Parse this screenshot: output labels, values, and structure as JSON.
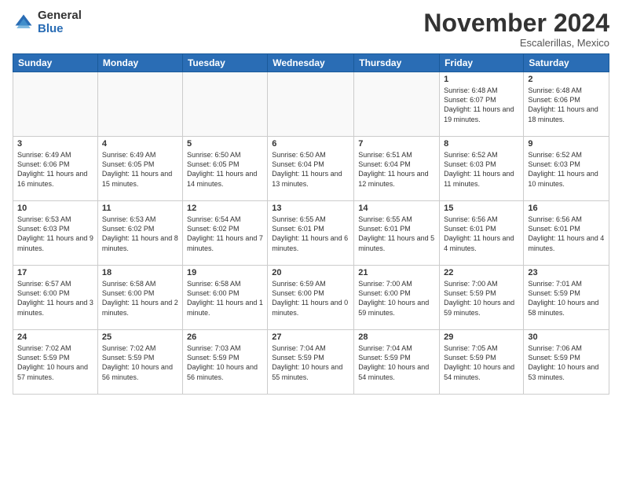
{
  "header": {
    "logo_general": "General",
    "logo_blue": "Blue",
    "month_title": "November 2024",
    "location": "Escalerillas, Mexico"
  },
  "weekdays": [
    "Sunday",
    "Monday",
    "Tuesday",
    "Wednesday",
    "Thursday",
    "Friday",
    "Saturday"
  ],
  "weeks": [
    [
      {
        "day": "",
        "info": ""
      },
      {
        "day": "",
        "info": ""
      },
      {
        "day": "",
        "info": ""
      },
      {
        "day": "",
        "info": ""
      },
      {
        "day": "",
        "info": ""
      },
      {
        "day": "1",
        "info": "Sunrise: 6:48 AM\nSunset: 6:07 PM\nDaylight: 11 hours and 19 minutes."
      },
      {
        "day": "2",
        "info": "Sunrise: 6:48 AM\nSunset: 6:06 PM\nDaylight: 11 hours and 18 minutes."
      }
    ],
    [
      {
        "day": "3",
        "info": "Sunrise: 6:49 AM\nSunset: 6:06 PM\nDaylight: 11 hours and 16 minutes."
      },
      {
        "day": "4",
        "info": "Sunrise: 6:49 AM\nSunset: 6:05 PM\nDaylight: 11 hours and 15 minutes."
      },
      {
        "day": "5",
        "info": "Sunrise: 6:50 AM\nSunset: 6:05 PM\nDaylight: 11 hours and 14 minutes."
      },
      {
        "day": "6",
        "info": "Sunrise: 6:50 AM\nSunset: 6:04 PM\nDaylight: 11 hours and 13 minutes."
      },
      {
        "day": "7",
        "info": "Sunrise: 6:51 AM\nSunset: 6:04 PM\nDaylight: 11 hours and 12 minutes."
      },
      {
        "day": "8",
        "info": "Sunrise: 6:52 AM\nSunset: 6:03 PM\nDaylight: 11 hours and 11 minutes."
      },
      {
        "day": "9",
        "info": "Sunrise: 6:52 AM\nSunset: 6:03 PM\nDaylight: 11 hours and 10 minutes."
      }
    ],
    [
      {
        "day": "10",
        "info": "Sunrise: 6:53 AM\nSunset: 6:03 PM\nDaylight: 11 hours and 9 minutes."
      },
      {
        "day": "11",
        "info": "Sunrise: 6:53 AM\nSunset: 6:02 PM\nDaylight: 11 hours and 8 minutes."
      },
      {
        "day": "12",
        "info": "Sunrise: 6:54 AM\nSunset: 6:02 PM\nDaylight: 11 hours and 7 minutes."
      },
      {
        "day": "13",
        "info": "Sunrise: 6:55 AM\nSunset: 6:01 PM\nDaylight: 11 hours and 6 minutes."
      },
      {
        "day": "14",
        "info": "Sunrise: 6:55 AM\nSunset: 6:01 PM\nDaylight: 11 hours and 5 minutes."
      },
      {
        "day": "15",
        "info": "Sunrise: 6:56 AM\nSunset: 6:01 PM\nDaylight: 11 hours and 4 minutes."
      },
      {
        "day": "16",
        "info": "Sunrise: 6:56 AM\nSunset: 6:01 PM\nDaylight: 11 hours and 4 minutes."
      }
    ],
    [
      {
        "day": "17",
        "info": "Sunrise: 6:57 AM\nSunset: 6:00 PM\nDaylight: 11 hours and 3 minutes."
      },
      {
        "day": "18",
        "info": "Sunrise: 6:58 AM\nSunset: 6:00 PM\nDaylight: 11 hours and 2 minutes."
      },
      {
        "day": "19",
        "info": "Sunrise: 6:58 AM\nSunset: 6:00 PM\nDaylight: 11 hours and 1 minute."
      },
      {
        "day": "20",
        "info": "Sunrise: 6:59 AM\nSunset: 6:00 PM\nDaylight: 11 hours and 0 minutes."
      },
      {
        "day": "21",
        "info": "Sunrise: 7:00 AM\nSunset: 6:00 PM\nDaylight: 10 hours and 59 minutes."
      },
      {
        "day": "22",
        "info": "Sunrise: 7:00 AM\nSunset: 5:59 PM\nDaylight: 10 hours and 59 minutes."
      },
      {
        "day": "23",
        "info": "Sunrise: 7:01 AM\nSunset: 5:59 PM\nDaylight: 10 hours and 58 minutes."
      }
    ],
    [
      {
        "day": "24",
        "info": "Sunrise: 7:02 AM\nSunset: 5:59 PM\nDaylight: 10 hours and 57 minutes."
      },
      {
        "day": "25",
        "info": "Sunrise: 7:02 AM\nSunset: 5:59 PM\nDaylight: 10 hours and 56 minutes."
      },
      {
        "day": "26",
        "info": "Sunrise: 7:03 AM\nSunset: 5:59 PM\nDaylight: 10 hours and 56 minutes."
      },
      {
        "day": "27",
        "info": "Sunrise: 7:04 AM\nSunset: 5:59 PM\nDaylight: 10 hours and 55 minutes."
      },
      {
        "day": "28",
        "info": "Sunrise: 7:04 AM\nSunset: 5:59 PM\nDaylight: 10 hours and 54 minutes."
      },
      {
        "day": "29",
        "info": "Sunrise: 7:05 AM\nSunset: 5:59 PM\nDaylight: 10 hours and 54 minutes."
      },
      {
        "day": "30",
        "info": "Sunrise: 7:06 AM\nSunset: 5:59 PM\nDaylight: 10 hours and 53 minutes."
      }
    ]
  ]
}
